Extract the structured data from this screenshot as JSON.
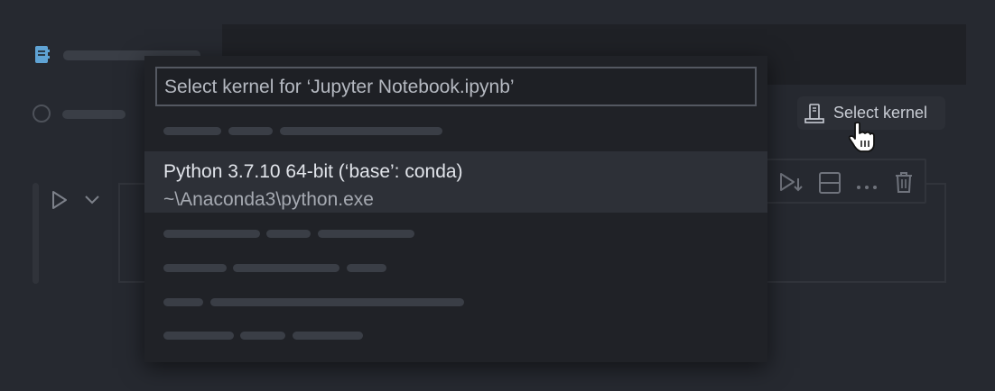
{
  "notebook": {
    "icon": "notebook-icon"
  },
  "kernel_button": {
    "label": "Select kernel",
    "icon": "kernel-server-icon"
  },
  "cell": {
    "run_icon": "play-icon",
    "expand_icon": "chevron-down-icon",
    "toolbar_icons": [
      "run-below-icon",
      "split-cell-icon",
      "more-icon",
      "trash-icon"
    ]
  },
  "kernel_picker": {
    "search_value": "Select kernel for ‘Jupyter Notebook.ipynb’",
    "selected_item": {
      "title": "Python 3.7.10 64-bit (‘base’: conda)",
      "path": "~\\Anaconda3\\python.exe"
    }
  },
  "colors": {
    "background": "#262930",
    "popup": "#202227",
    "selected": "#2d3037"
  }
}
